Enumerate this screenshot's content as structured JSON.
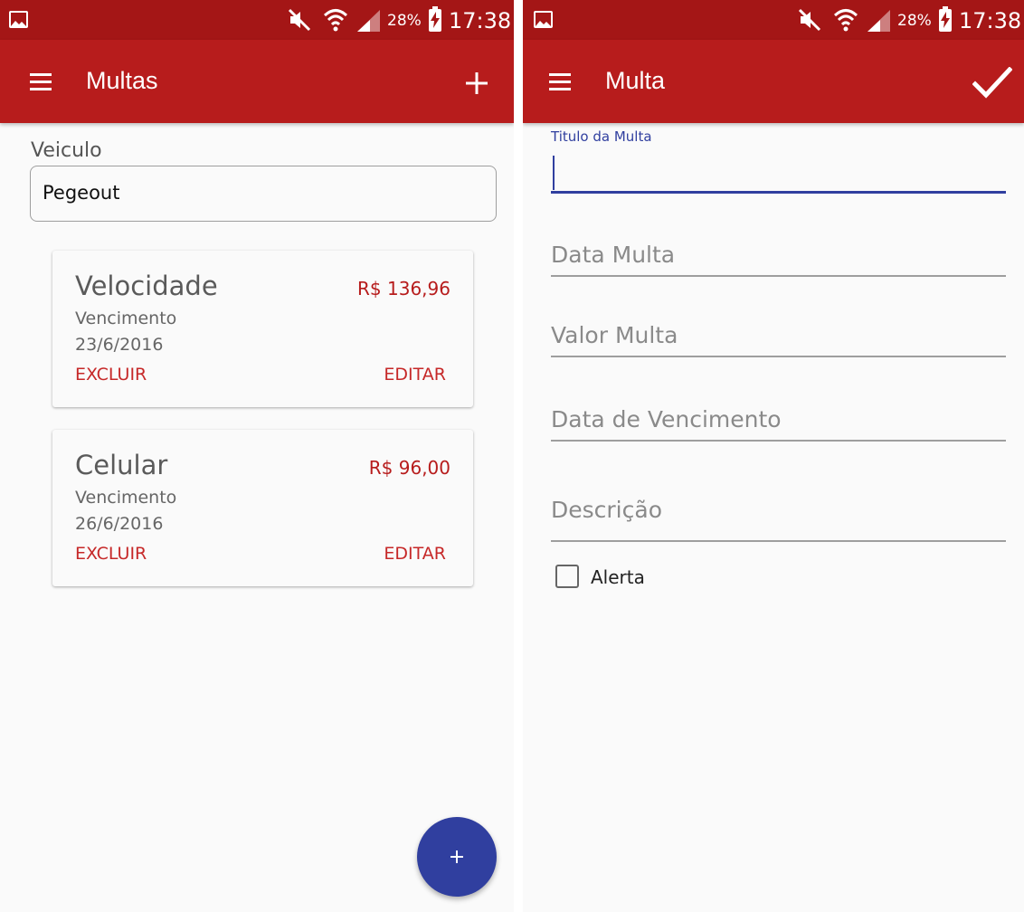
{
  "statusbar": {
    "battery_pct": "28%",
    "time": "17:38"
  },
  "screen_list": {
    "appbar_title": "Multas",
    "vehicle_label": "Veiculo",
    "vehicle_value": "Pegeout",
    "fines": [
      {
        "title": "Velocidade",
        "price": "R$ 136,96",
        "due_label": "Vencimento",
        "due_date": "23/6/2016",
        "delete_label": "EXCLUIR",
        "edit_label": "EDITAR"
      },
      {
        "title": "Celular",
        "price": "R$ 96,00",
        "due_label": "Vencimento",
        "due_date": "26/6/2016",
        "delete_label": "EXCLUIR",
        "edit_label": "EDITAR"
      }
    ]
  },
  "screen_form": {
    "appbar_title": "Multa",
    "title_field_label": "Titulo da Multa",
    "fields": [
      {
        "placeholder": "Data Multa"
      },
      {
        "placeholder": "Valor Multa"
      },
      {
        "placeholder": "Data de Vencimento"
      },
      {
        "placeholder": "Descrição"
      }
    ],
    "alert_label": "Alerta"
  },
  "colors": {
    "primary": "#b71c1c",
    "primary_dark": "#a41616",
    "accent": "#303f9f",
    "action_text": "#c62828"
  },
  "icons": [
    "gallery-icon",
    "mute-icon",
    "wifi-icon",
    "signal-icon",
    "battery-icon",
    "menu-icon",
    "add-icon",
    "check-icon"
  ]
}
